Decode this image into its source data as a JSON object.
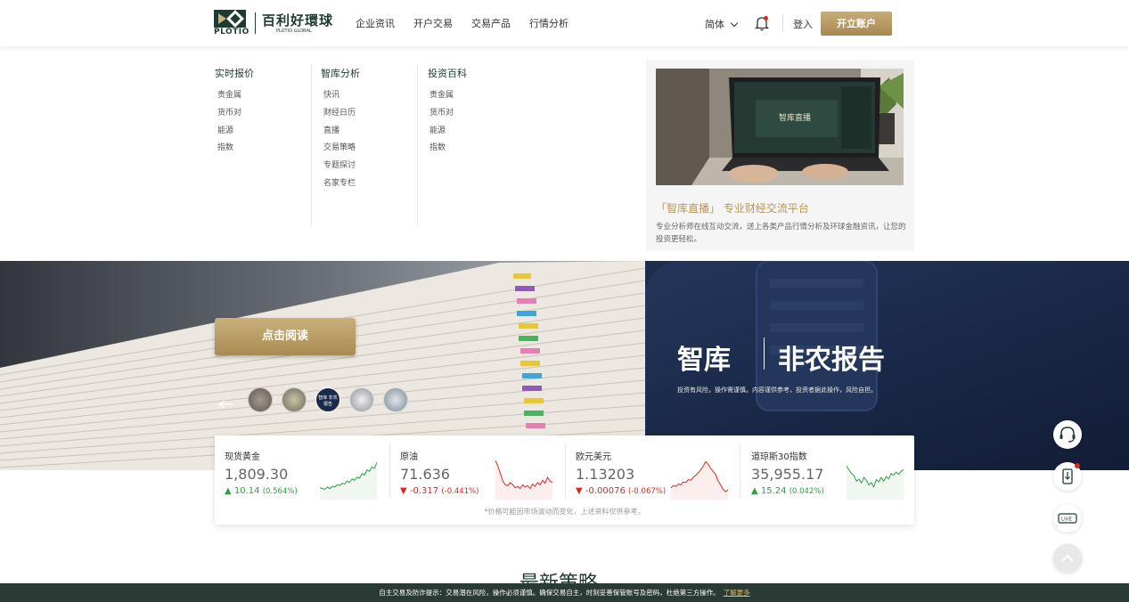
{
  "header": {
    "logo_en": "PLOTIO",
    "logo_cn": "百利好環球",
    "logo_sub": "PLOTIO GLOBAL",
    "nav": [
      "企业资讯",
      "开户交易",
      "交易产品",
      "行情分析"
    ],
    "language": "简体",
    "login": "登入",
    "open_account": "开立账户"
  },
  "menu": {
    "columns": [
      {
        "title": "实时报价",
        "items": [
          "贵金属",
          "货币对",
          "能源",
          "指数"
        ]
      },
      {
        "title": "智库分析",
        "items": [
          "快讯",
          "财经日历",
          "直播",
          "交易策略",
          "专题探讨",
          "名家专栏"
        ]
      },
      {
        "title": "投资百科",
        "items": [
          "贵金属",
          "货币对",
          "能源",
          "指数"
        ]
      }
    ],
    "promo": {
      "screen_title": "智库直播",
      "title": "「智库直播」 专业财经交流平台",
      "desc": "专业分析师在线互动交流，送上各类产品行情分析及环球金融资讯，让您的投资更轻松。"
    }
  },
  "banner": {
    "button": "点击阅读",
    "brand_left": "智库",
    "brand_right": "非农报告",
    "disclaimer": "投资有风险，操作需谨慎。内容谨供参考，投资者据此操作，风险自担。",
    "thumb_label": "智库 非农报告"
  },
  "quotes": {
    "items": [
      {
        "name": "现货黄金",
        "price": "1,809.30",
        "change": "10.14",
        "pct": "(0.564%)",
        "dir": "up",
        "spark": [
          0.22,
          0.2,
          0.18,
          0.24,
          0.2,
          0.26,
          0.24,
          0.3,
          0.28,
          0.34,
          0.32,
          0.4,
          0.36,
          0.46,
          0.42,
          0.5,
          0.48,
          0.6,
          0.56,
          0.7,
          0.66,
          0.78,
          0.74,
          0.9
        ]
      },
      {
        "name": "原油",
        "price": "71.636",
        "change": "-0.317",
        "pct": "(-0.441%)",
        "dir": "down",
        "spark": [
          0.95,
          0.8,
          0.6,
          0.4,
          0.3,
          0.28,
          0.36,
          0.3,
          0.22,
          0.26,
          0.2,
          0.3,
          0.24,
          0.28,
          0.2,
          0.32,
          0.26,
          0.36,
          0.3,
          0.42,
          0.34,
          0.5,
          0.4,
          0.36
        ]
      },
      {
        "name": "欧元美元",
        "price": "1.13203",
        "change": "-0.00076",
        "pct": "(-0.067%)",
        "dir": "down",
        "spark": [
          0.22,
          0.28,
          0.26,
          0.32,
          0.3,
          0.38,
          0.36,
          0.44,
          0.42,
          0.5,
          0.56,
          0.62,
          0.7,
          0.8,
          0.92,
          0.85,
          0.74,
          0.66,
          0.58,
          0.4,
          0.3,
          0.18,
          0.12,
          0.16
        ]
      },
      {
        "name": "道琼斯30指数",
        "price": "35,955.17",
        "change": "15.24",
        "pct": "(0.042%)",
        "dir": "up",
        "spark": [
          0.8,
          0.7,
          0.6,
          0.55,
          0.4,
          0.45,
          0.35,
          0.5,
          0.42,
          0.3,
          0.36,
          0.24,
          0.44,
          0.38,
          0.5,
          0.4,
          0.52,
          0.46,
          0.6,
          0.56,
          0.64,
          0.58,
          0.66,
          0.7
        ]
      }
    ],
    "note": "*价格可能因市场波动而变化，上述资料仅供参考。"
  },
  "side_buttons": [
    "headset-icon",
    "download-icon",
    "live-icon",
    "back-to-top-icon"
  ],
  "side_live_label": "LIVE",
  "section": {
    "title": "最新策略"
  },
  "footer": {
    "notice": "自主交易及防诈提示：交易潜在风险，操作必须谨慎。确保交易自主，时刻妥善保管账号及密码，杜绝第三方操作。",
    "more": "了解更多"
  },
  "colors": {
    "brand_green": "#1f3b30",
    "gold": "#b8965a",
    "up": "#2f9e44",
    "down": "#d52b1e",
    "navy": "#1b2a48",
    "footer_bg": "#2a3b35"
  }
}
